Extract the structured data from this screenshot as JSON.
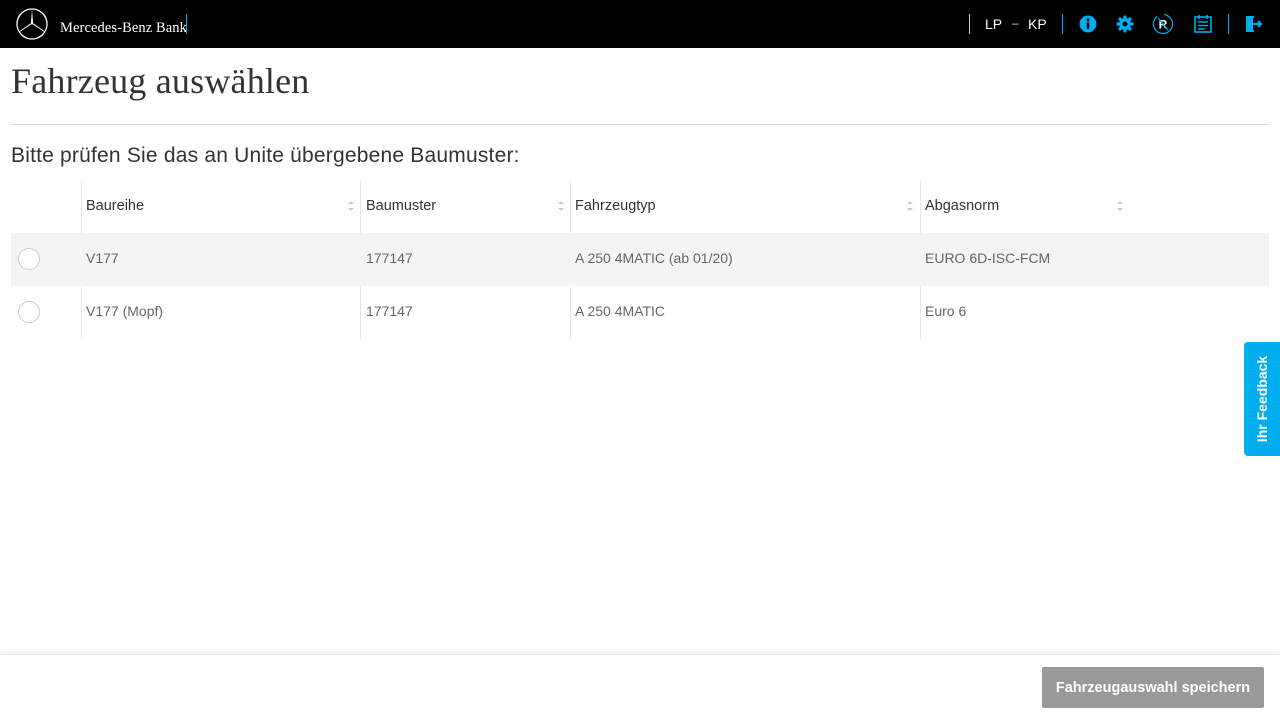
{
  "header": {
    "brand": "Mercedes-Benz Bank",
    "user_left": "LP",
    "user_dash": "–",
    "user_right": "KP",
    "icons": [
      "info-icon",
      "gear-icon",
      "user-id-icon",
      "calendar-checklist-icon",
      "logout-icon"
    ],
    "accent_color": "#00adef"
  },
  "page": {
    "title": "Fahrzeug auswählen",
    "subtitle": "Bitte prüfen Sie das an Unite übergebene Baumuster:"
  },
  "table": {
    "columns": [
      "Baureihe",
      "Baumuster",
      "Fahrzeugtyp",
      "Abgasnorm"
    ],
    "rows": [
      {
        "baureihe": "V177",
        "baumuster": "177147",
        "fahrzeugtyp": "A 250 4MATIC (ab 01/20)",
        "abgasnorm": "EURO 6D-ISC-FCM"
      },
      {
        "baureihe": "V177 (Mopf)",
        "baumuster": "177147",
        "fahrzeugtyp": "A 250 4MATIC",
        "abgasnorm": "Euro 6"
      }
    ]
  },
  "feedback": {
    "label": "Ihr Feedback"
  },
  "footer": {
    "save_label": "Fahrzeugauswahl speichern",
    "button_color": "#999999"
  }
}
